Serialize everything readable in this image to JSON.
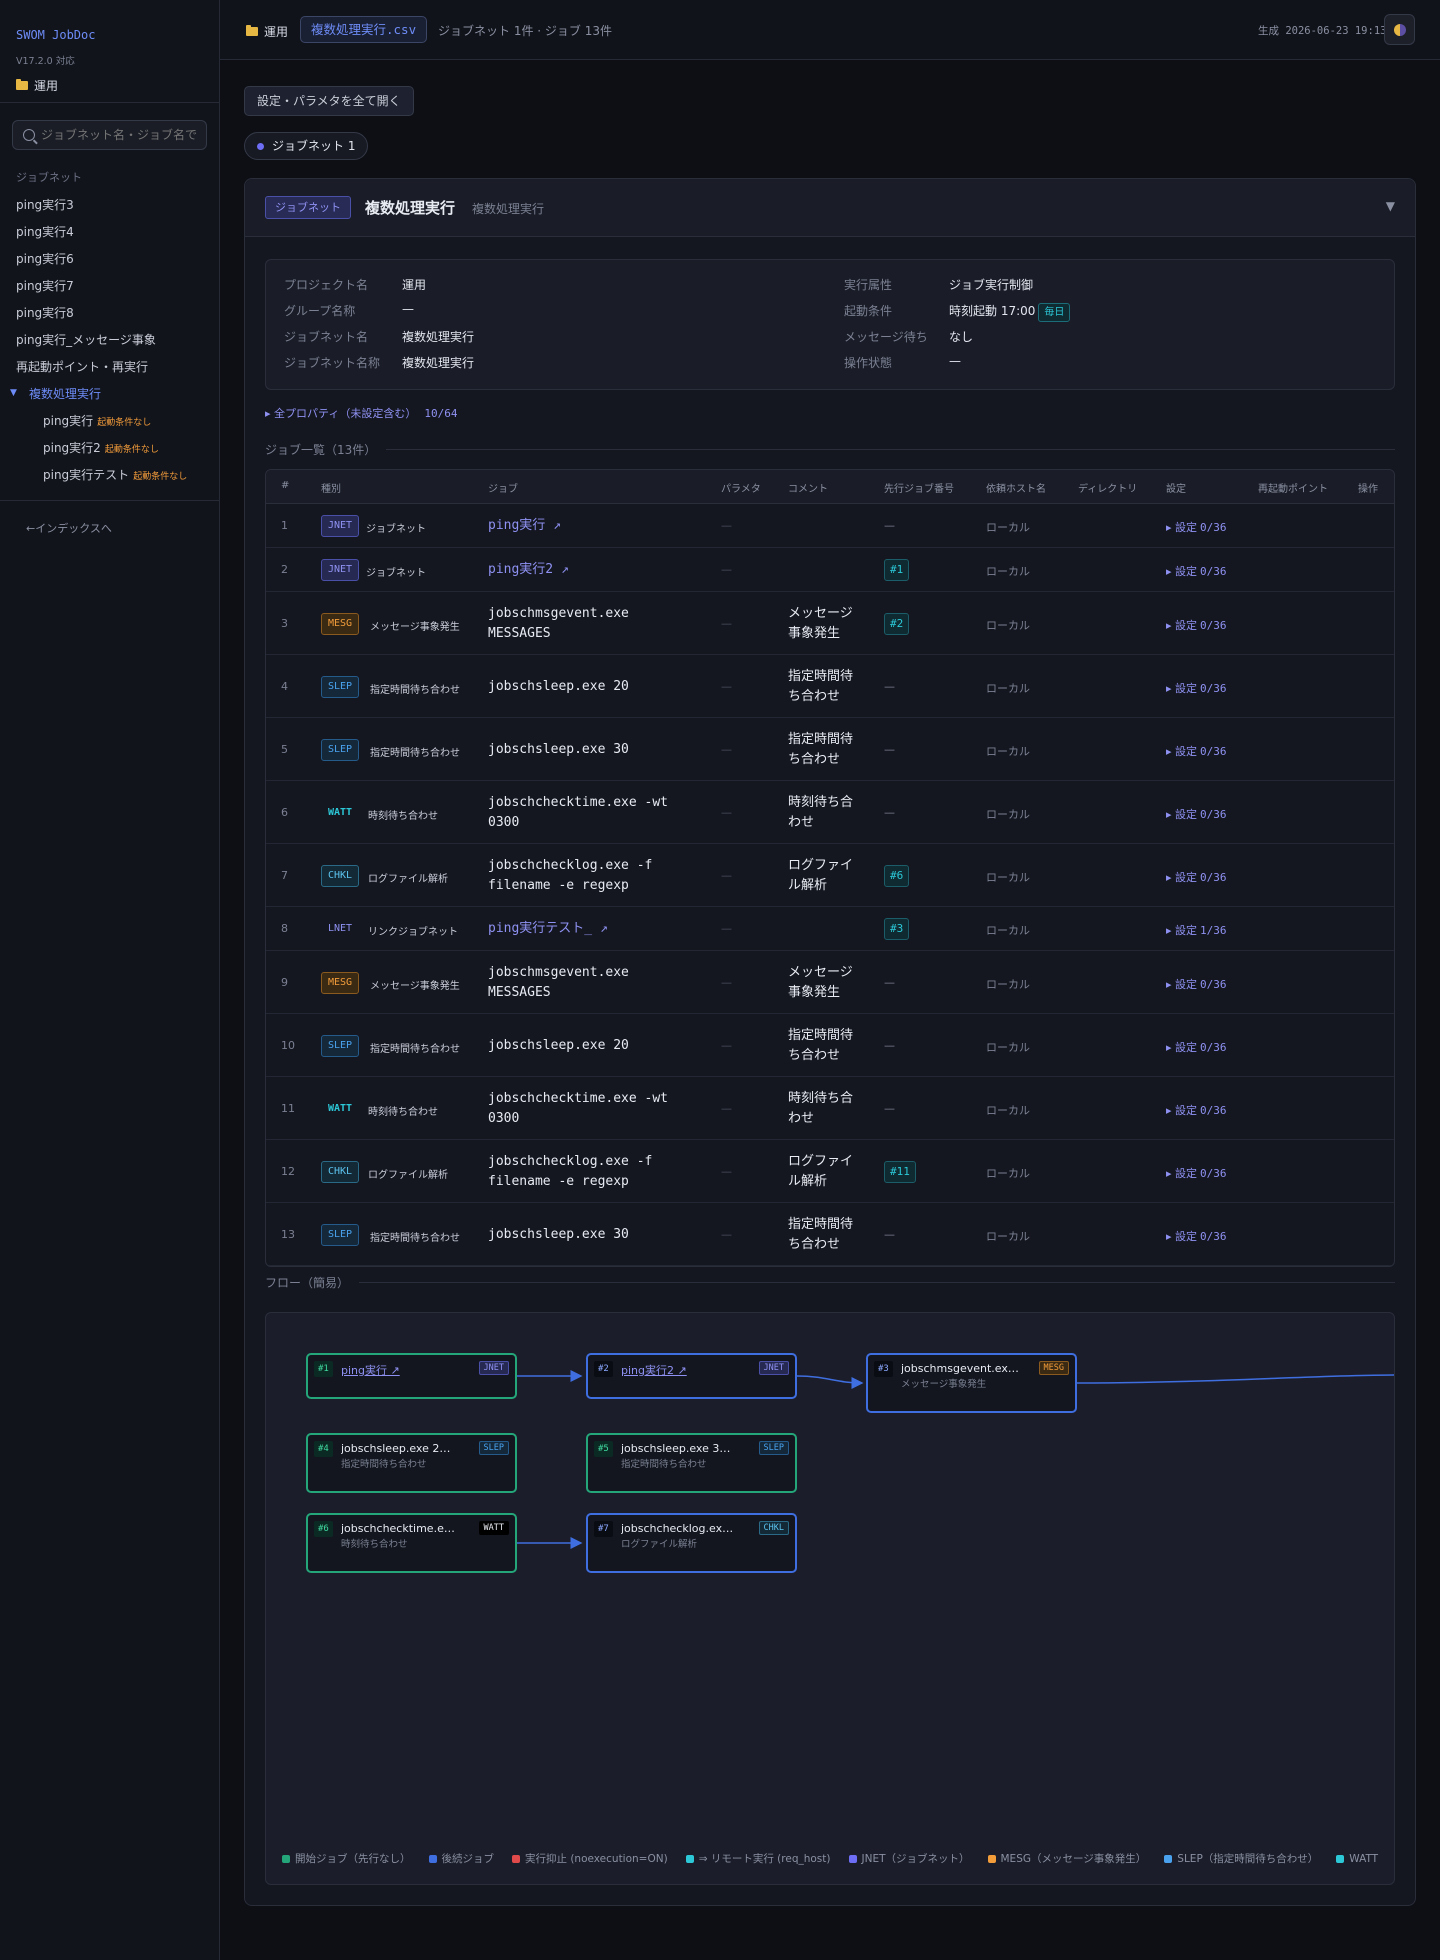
{
  "app": {
    "title": "SWOM JobDoc",
    "version": "V17.2.0 対応",
    "folder": "運用"
  },
  "sidebar": {
    "search_placeholder": "ジョブネット名・ジョブ名で",
    "section": "ジョブネット",
    "items": [
      "ping実行3",
      "ping実行4",
      "ping実行6",
      "ping実行7",
      "ping実行8",
      "ping実行_メッセージ事象",
      "再起動ポイント・再実行"
    ],
    "active": "複数処理実行",
    "subitems": [
      {
        "label": "ping実行",
        "note": "起動条件なし"
      },
      {
        "label": "ping実行2",
        "note": "起動条件なし"
      },
      {
        "label": "ping実行テスト",
        "note": "起動条件なし"
      }
    ],
    "back": "←インデックスへ"
  },
  "topbar": {
    "folder": "運用",
    "file": "複数処理実行.csv",
    "count": "ジョブネット 1件 · ジョブ 13件",
    "generated": "生成 2026-06-23 19:13"
  },
  "main": {
    "open_all": "設定・パラメタを全て開く",
    "pill": "ジョブネット 1",
    "card": {
      "badge": "ジョブネット",
      "title": "複数処理実行",
      "subtitle": "複数処理実行",
      "caret": "▼"
    },
    "props_left": [
      {
        "k": "プロジェクト名",
        "v": "運用"
      },
      {
        "k": "グループ名称",
        "v": "—"
      },
      {
        "k": "ジョブネット名",
        "v": "複数処理実行"
      },
      {
        "k": "ジョブネット名称",
        "v": "複数処理実行"
      }
    ],
    "props_right": [
      {
        "k": "実行属性",
        "v": "ジョブ実行制御"
      },
      {
        "k": "起動条件",
        "v": "時刻起動 17:00",
        "tag": "毎日"
      },
      {
        "k": "メッセージ待ち",
        "v": "なし"
      },
      {
        "k": "操作状態",
        "v": "—"
      }
    ],
    "all_props": "▸ 全プロパティ（未設定含む）",
    "all_props_count": "10/64",
    "jobs_label": "ジョブ一覧（13件）",
    "flow_label": "フロー（簡易）"
  },
  "table": {
    "headers": [
      "#",
      "種別",
      "ジョブ",
      "パラメタ",
      "コメント",
      "先行ジョブ番号",
      "依頼ホスト名",
      "ディレクトリ",
      "設定",
      "再起動ポイント",
      "操作"
    ],
    "rows": [
      {
        "n": "1",
        "type": "JNET",
        "kind": "ジョブネット",
        "job": "ping実行 ↗",
        "link": true,
        "param": "—",
        "comment": "",
        "prev": "—",
        "host": "ローカル",
        "set": "0/36"
      },
      {
        "n": "2",
        "type": "JNET",
        "kind": "ジョブネット",
        "job": "ping実行2 ↗",
        "link": true,
        "param": "—",
        "comment": "",
        "prev": "#1",
        "host": "ローカル",
        "set": "0/36"
      },
      {
        "n": "3",
        "type": "MESG",
        "kind": "メッセージ事象発生",
        "job": "jobschmsgevent.exe MESSAGES",
        "param": "—",
        "comment": "メッセージ事象発生",
        "prev": "#2",
        "host": "ローカル",
        "set": "0/36"
      },
      {
        "n": "4",
        "type": "SLEP",
        "kind": "指定時間待ち合わせ",
        "job": "jobschsleep.exe 20",
        "param": "—",
        "comment": "指定時間待ち合わせ",
        "prev": "—",
        "host": "ローカル",
        "set": "0/36"
      },
      {
        "n": "5",
        "type": "SLEP",
        "kind": "指定時間待ち合わせ",
        "job": "jobschsleep.exe 30",
        "param": "—",
        "comment": "指定時間待ち合わせ",
        "prev": "—",
        "host": "ローカル",
        "set": "0/36"
      },
      {
        "n": "6",
        "type": "WATT",
        "kind": "時刻待ち合わせ",
        "job": "jobschchecktime.exe -wt 0300",
        "param": "—",
        "comment": "時刻待ち合わせ",
        "prev": "—",
        "host": "ローカル",
        "set": "0/36"
      },
      {
        "n": "7",
        "type": "CHKL",
        "kind": "ログファイル解析",
        "job": "jobschchecklog.exe -f filename -e regexp",
        "param": "—",
        "comment": "ログファイル解析",
        "prev": "#6",
        "host": "ローカル",
        "set": "0/36"
      },
      {
        "n": "8",
        "type": "LNET",
        "kind": "リンクジョブネット",
        "job": "ping実行テスト_ ↗",
        "link": true,
        "param": "—",
        "comment": "",
        "prev": "#3",
        "host": "ローカル",
        "set": "1/36"
      },
      {
        "n": "9",
        "type": "MESG",
        "kind": "メッセージ事象発生",
        "job": "jobschmsgevent.exe MESSAGES",
        "param": "—",
        "comment": "メッセージ事象発生",
        "prev": "—",
        "host": "ローカル",
        "set": "0/36"
      },
      {
        "n": "10",
        "type": "SLEP",
        "kind": "指定時間待ち合わせ",
        "job": "jobschsleep.exe 20",
        "param": "—",
        "comment": "指定時間待ち合わせ",
        "prev": "—",
        "host": "ローカル",
        "set": "0/36"
      },
      {
        "n": "11",
        "type": "WATT",
        "kind": "時刻待ち合わせ",
        "job": "jobschchecktime.exe -wt 0300",
        "param": "—",
        "comment": "時刻待ち合わせ",
        "prev": "—",
        "host": "ローカル",
        "set": "0/36"
      },
      {
        "n": "12",
        "type": "CHKL",
        "kind": "ログファイル解析",
        "job": "jobschchecklog.exe -f filename -e regexp",
        "param": "—",
        "comment": "ログファイル解析",
        "prev": "#11",
        "host": "ローカル",
        "set": "0/36"
      },
      {
        "n": "13",
        "type": "SLEP",
        "kind": "指定時間待ち合わせ",
        "job": "jobschsleep.exe 30",
        "param": "—",
        "comment": "指定時間待ち合わせ",
        "prev": "—",
        "host": "ローカル",
        "set": "0/36"
      }
    ],
    "set_label": "▸ 設定"
  },
  "flow": {
    "nodes": [
      {
        "id": "#1",
        "title": "ping実行 ↗",
        "tag": "JNET",
        "link": true
      },
      {
        "id": "#2",
        "title": "ping実行2 ↗",
        "tag": "JNET",
        "link": true
      },
      {
        "id": "#3",
        "title": "jobschmsgevent.ex…",
        "sub": "メッセージ事象発生",
        "tag": "MESG"
      },
      {
        "id": "#4",
        "title": "jobschsleep.exe 2…",
        "sub": "指定時間待ち合わせ",
        "tag": "SLEP"
      },
      {
        "id": "#5",
        "title": "jobschsleep.exe 3…",
        "sub": "指定時間待ち合わせ",
        "tag": "SLEP"
      },
      {
        "id": "#6",
        "title": "jobschchecktime.e…",
        "sub": "時刻待ち合わせ",
        "tag": "WATT"
      },
      {
        "id": "#7",
        "title": "jobschchecklog.ex…",
        "sub": "ログファイル解析",
        "tag": "CHKL"
      }
    ],
    "legend": [
      {
        "label": "開始ジョブ（先行なし）",
        "color": "#25a57a"
      },
      {
        "label": "後続ジョブ",
        "color": "#3f6ee0"
      },
      {
        "label": "実行抑止 (noexecution=ON)",
        "color": "#e04a4a"
      },
      {
        "label": "⇒ リモート実行 (req_host)",
        "color": "#2cc8d8"
      },
      {
        "label": "JNET（ジョブネット）",
        "color": "#6d6ef5"
      },
      {
        "label": "MESG（メッセージ事象発生）",
        "color": "#f29c3a"
      },
      {
        "label": "SLEP（指定時間待ち合わせ）",
        "color": "#4aa2ee"
      },
      {
        "label": "WATT",
        "color": "#2cc8d8"
      }
    ]
  }
}
